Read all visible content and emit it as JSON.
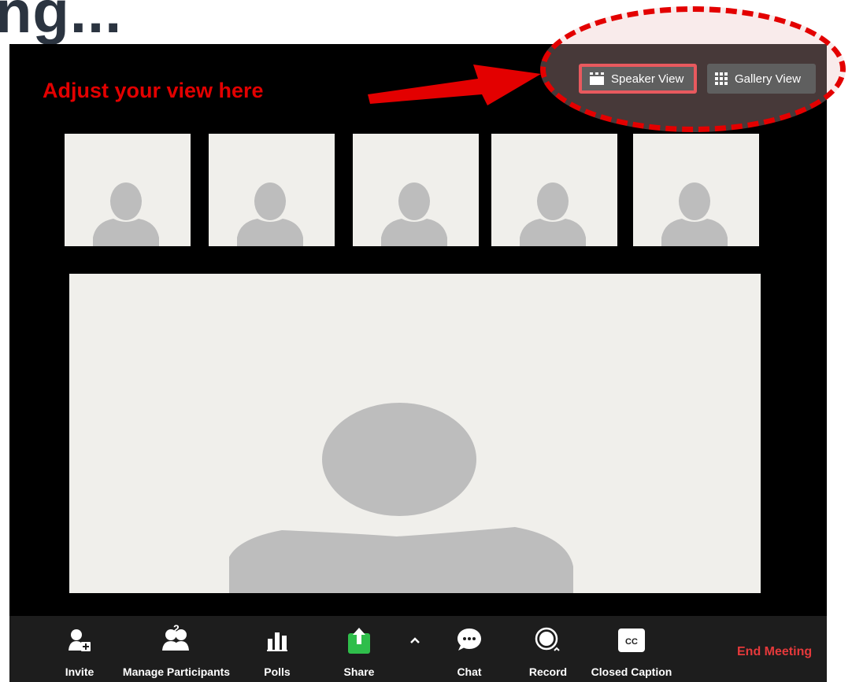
{
  "slide": {
    "title": "ng..."
  },
  "annotation": {
    "text": "Adjust your view here",
    "color": "#e30000"
  },
  "view_toggle": {
    "speaker_label": "Speaker View",
    "gallery_label": "Gallery View",
    "speaker_selected": true
  },
  "thumbnails": [
    {
      "icon": "person-silhouette-icon"
    },
    {
      "icon": "person-silhouette-icon"
    },
    {
      "icon": "person-silhouette-icon"
    },
    {
      "icon": "person-silhouette-icon"
    },
    {
      "icon": "person-silhouette-icon"
    }
  ],
  "toolbar": {
    "invite": "Invite",
    "manage_participants": "Manage Participants",
    "participant_count": "2",
    "polls": "Polls",
    "share": "Share",
    "chat": "Chat",
    "record": "Record",
    "closed_caption": "Closed Caption",
    "cc_badge": "CC",
    "end_meeting": "End Meeting"
  },
  "colors": {
    "share_green": "#2fbe4b",
    "end_red": "#e5393b",
    "highlight_border": "#e8595e"
  }
}
